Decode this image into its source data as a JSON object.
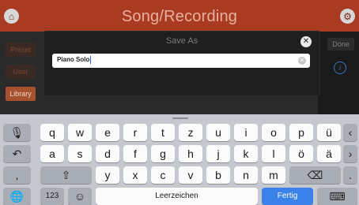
{
  "app": {
    "title": "Song/Recording",
    "sidebar": [
      "Preset",
      "User",
      "Library"
    ],
    "done_label": "Done",
    "info_icon": "i"
  },
  "dialog": {
    "title": "Save As",
    "input_value": "Piano Solo"
  },
  "keyboard": {
    "row1": [
      "q",
      "w",
      "e",
      "r",
      "t",
      "z",
      "u",
      "i",
      "o",
      "p",
      "ü"
    ],
    "row2": [
      "a",
      "s",
      "d",
      "f",
      "g",
      "h",
      "j",
      "k",
      "l",
      "ö",
      "ä"
    ],
    "row3": [
      "y",
      "x",
      "c",
      "v",
      "b",
      "n",
      "m"
    ],
    "numbers_label": "123",
    "space_label": "Leerzeichen",
    "return_label": "Fertig",
    "comma": ",",
    "period": "."
  },
  "colors": {
    "accent": "#a83b22",
    "return_key": "#3a82ea"
  }
}
